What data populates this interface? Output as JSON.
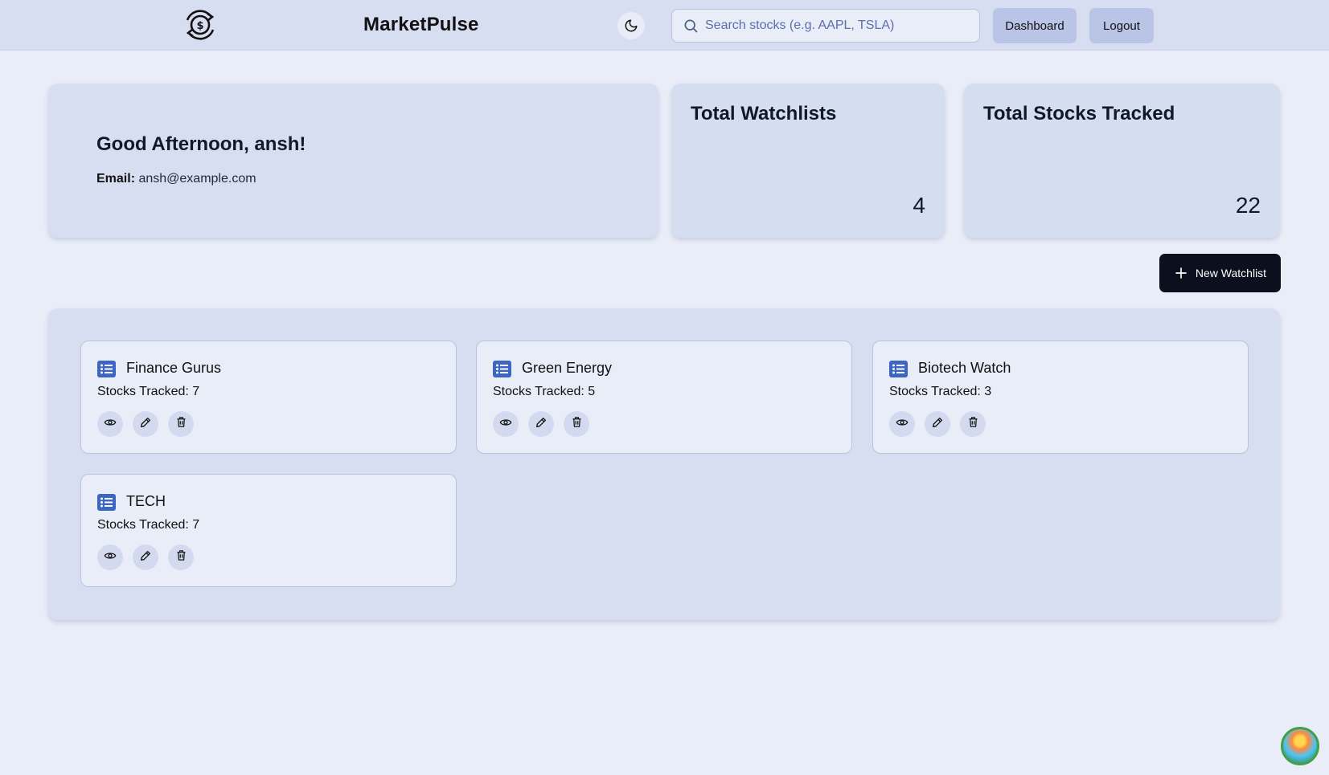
{
  "header": {
    "brand": "MarketPulse",
    "search_placeholder": "Search stocks (e.g. AAPL, TSLA)",
    "search_value": "",
    "dashboard_label": "Dashboard",
    "logout_label": "Logout"
  },
  "welcome": {
    "greeting": "Good Afternoon, ansh!",
    "email_label": "Email:",
    "email_value": "ansh@example.com"
  },
  "stats": {
    "watchlists_title": "Total Watchlists",
    "watchlists_value": "4",
    "stocks_title": "Total Stocks Tracked",
    "stocks_value": "22"
  },
  "new_watchlist_label": "New Watchlist",
  "watchlists": [
    {
      "name": "Finance Gurus",
      "count_text": "Stocks Tracked: 7"
    },
    {
      "name": "Green Energy",
      "count_text": "Stocks Tracked: 5"
    },
    {
      "name": "Biotech Watch",
      "count_text": "Stocks Tracked: 3"
    },
    {
      "name": "TECH",
      "count_text": "Stocks Tracked: 7"
    }
  ],
  "icons": {
    "logo": "currency-exchange-icon",
    "theme": "moon-icon",
    "search": "search-icon",
    "list": "list-icon",
    "view": "eye-icon",
    "edit": "pencil-icon",
    "delete": "trash-icon",
    "add": "plus-icon"
  },
  "colors": {
    "accent_blue": "#3b66c4",
    "header_bg": "#d8def1",
    "page_bg": "#e9edf8",
    "primary_dark": "#0b0f1e"
  }
}
